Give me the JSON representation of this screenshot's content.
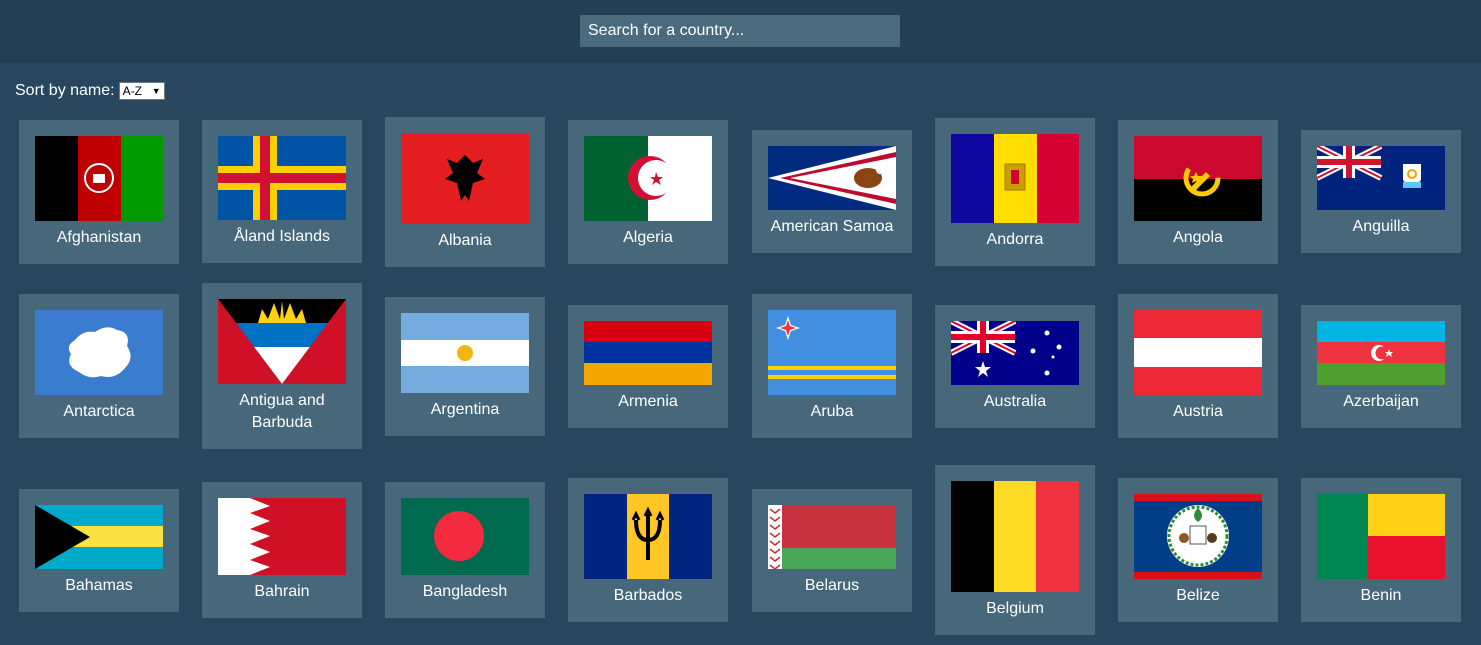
{
  "search": {
    "placeholder": "Search for a country..."
  },
  "sort": {
    "label": "Sort by name:",
    "selected": "A-Z",
    "arrow": "▼"
  },
  "countries": [
    {
      "name": "Afghanistan",
      "flag": "afghanistan-flag"
    },
    {
      "name": "Åland Islands",
      "flag": "aland-islands-flag"
    },
    {
      "name": "Albania",
      "flag": "albania-flag"
    },
    {
      "name": "Algeria",
      "flag": "algeria-flag"
    },
    {
      "name": "American Samoa",
      "flag": "american-samoa-flag"
    },
    {
      "name": "Andorra",
      "flag": "andorra-flag"
    },
    {
      "name": "Angola",
      "flag": "angola-flag"
    },
    {
      "name": "Anguilla",
      "flag": "anguilla-flag"
    },
    {
      "name": "Antarctica",
      "flag": "antarctica-flag"
    },
    {
      "name": "Antigua and Barbuda",
      "flag": "antigua-and-barbuda-flag"
    },
    {
      "name": "Argentina",
      "flag": "argentina-flag"
    },
    {
      "name": "Armenia",
      "flag": "armenia-flag"
    },
    {
      "name": "Aruba",
      "flag": "aruba-flag"
    },
    {
      "name": "Australia",
      "flag": "australia-flag"
    },
    {
      "name": "Austria",
      "flag": "austria-flag"
    },
    {
      "name": "Azerbaijan",
      "flag": "azerbaijan-flag"
    },
    {
      "name": "Bahamas",
      "flag": "bahamas-flag"
    },
    {
      "name": "Bahrain",
      "flag": "bahrain-flag"
    },
    {
      "name": "Bangladesh",
      "flag": "bangladesh-flag"
    },
    {
      "name": "Barbados",
      "flag": "barbados-flag"
    },
    {
      "name": "Belarus",
      "flag": "belarus-flag"
    },
    {
      "name": "Belgium",
      "flag": "belgium-flag"
    },
    {
      "name": "Belize",
      "flag": "belize-flag"
    },
    {
      "name": "Benin",
      "flag": "benin-flag"
    }
  ]
}
